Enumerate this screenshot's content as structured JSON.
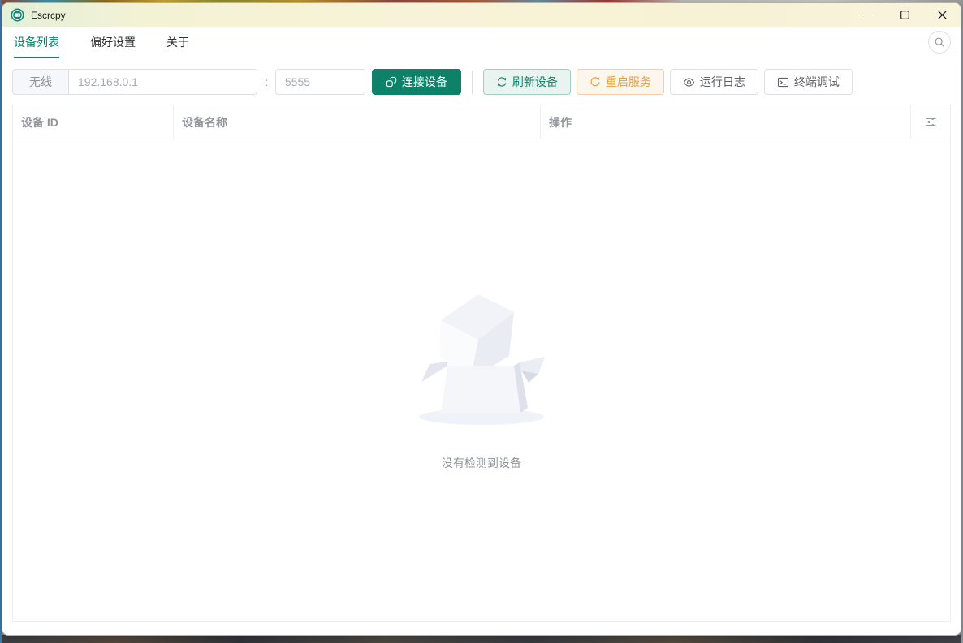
{
  "window": {
    "title": "Escrcpy",
    "controls": {
      "minimize": "minimize",
      "maximize": "maximize",
      "close": "close"
    }
  },
  "tabs": [
    {
      "label": "设备列表",
      "active": true
    },
    {
      "label": "偏好设置",
      "active": false
    },
    {
      "label": "关于",
      "active": false
    }
  ],
  "toolbar": {
    "wireless_label": "无线",
    "host_value": "192.168.0.1",
    "separator": ":",
    "port_value": "5555",
    "connect_label": "连接设备",
    "refresh_label": "刷新设备",
    "restart_label": "重启服务",
    "logs_label": "运行日志",
    "terminal_label": "终端调试"
  },
  "table": {
    "columns": [
      {
        "label": "设备 ID"
      },
      {
        "label": "设备名称"
      },
      {
        "label": "操作"
      }
    ],
    "rows": [],
    "empty_text": "没有检测到设备"
  },
  "icons": {
    "app": "escrcpy-logo-icon",
    "search": "search-icon",
    "connect": "link-icon",
    "refresh": "refresh-icon",
    "restart": "refresh-right-icon",
    "logs": "eye-icon",
    "terminal": "terminal-icon",
    "column_filter": "sliders-icon",
    "minimize": "minimize-icon",
    "maximize": "maximize-icon",
    "close": "close-icon"
  },
  "colors": {
    "primary": "#0e8169",
    "warning": "#e6a23c",
    "success_plain_bg": "#e9f4f0",
    "warning_plain_bg": "#fdf6ec",
    "border": "#dcdfe6",
    "table_border": "#ebeef5",
    "header_text": "#909399",
    "muted_text": "#a8abb2",
    "titlebar_gradient": [
      "#e4f0d8",
      "#f8f3d8"
    ]
  }
}
